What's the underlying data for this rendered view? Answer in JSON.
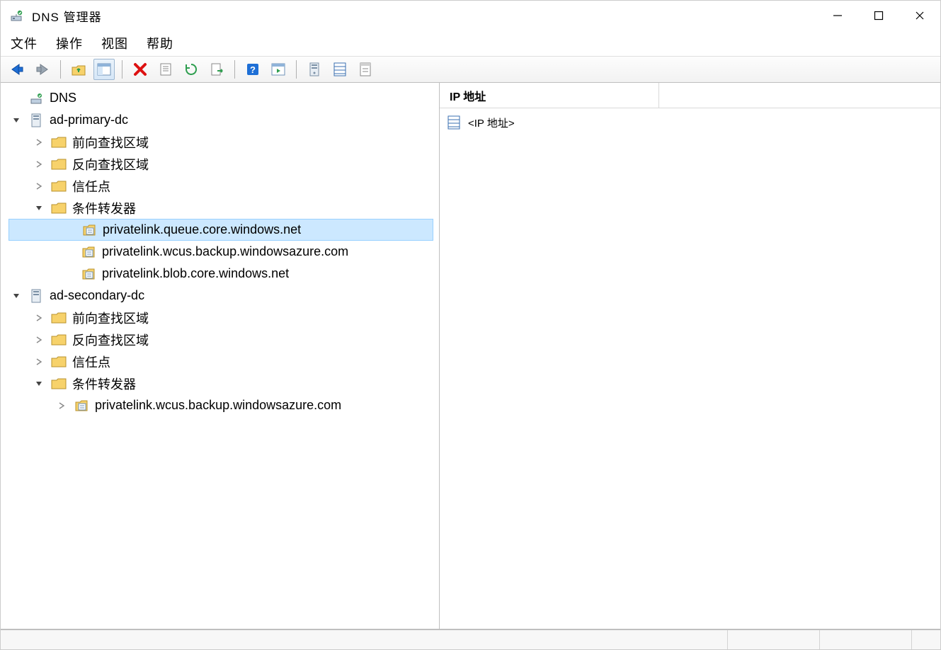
{
  "app": {
    "title": "DNS 管理器"
  },
  "menu": {
    "file": "文件",
    "action": "操作",
    "view": "视图",
    "help": "帮助"
  },
  "detail": {
    "column_ip": "IP 地址",
    "placeholder_row": "<IP 地址>"
  },
  "tree": {
    "root": "DNS",
    "server1": "ad-primary-dc",
    "server2": "ad-secondary-dc",
    "fwd_zone": "前向查找区域",
    "rev_zone": "反向查找区域",
    "trust_points": "信任点",
    "cond_forwarders": "条件转发器",
    "cf1": "privatelink.queue.core.windows.net",
    "cf2": "privatelink.wcus.backup.windowsazure.com",
    "cf3": "privatelink.blob.core.windows.net",
    "cf4": "privatelink.wcus.backup.windowsazure.com"
  }
}
